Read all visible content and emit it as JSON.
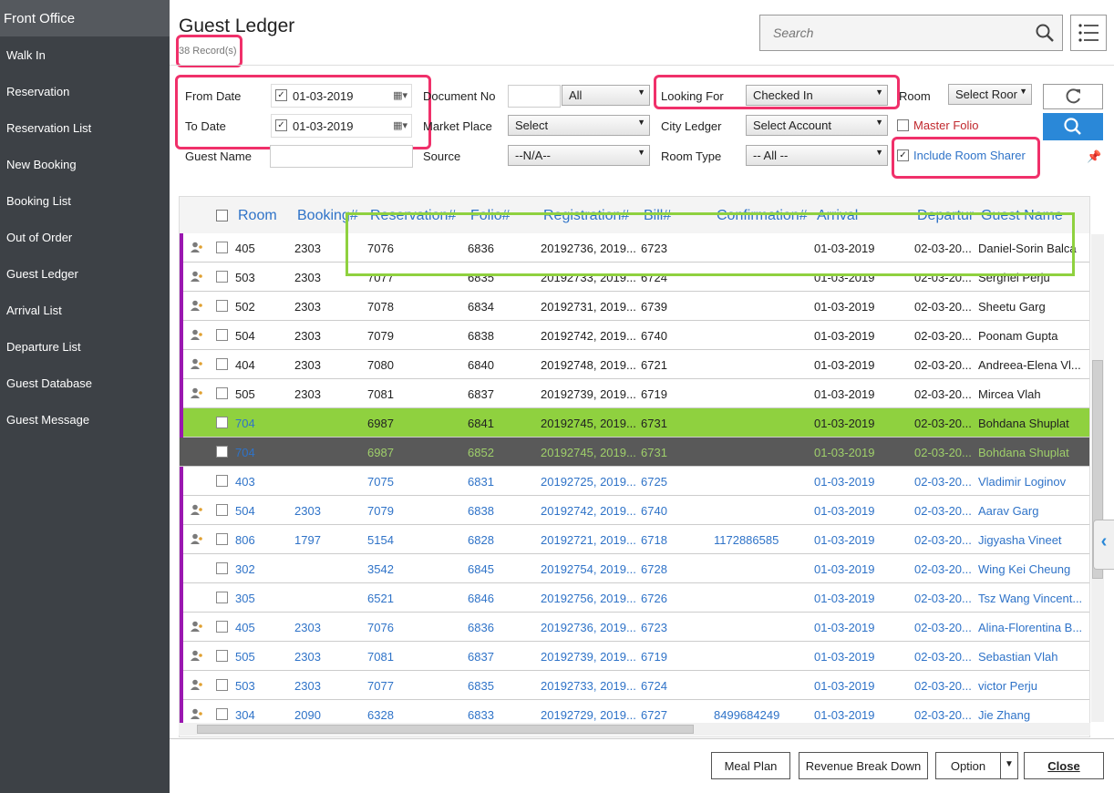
{
  "sidebar": {
    "header": "Front Office",
    "items": [
      "Walk In",
      "Reservation",
      "Reservation List",
      "New Booking",
      "Booking List",
      "Out of Order",
      "Guest Ledger",
      "Arrival List",
      "Departure List",
      "Guest Database",
      "Guest Message"
    ]
  },
  "page": {
    "title": "Guest Ledger",
    "record_count": "38 Record(s)",
    "search_placeholder": "Search"
  },
  "filters": {
    "from_date_label": "From Date",
    "from_date_value": "01-03-2019",
    "to_date_label": "To Date",
    "to_date_value": "01-03-2019",
    "guest_name_label": "Guest Name",
    "document_no_label": "Document No",
    "document_no_select": "All",
    "market_place_label": "Market Place",
    "market_place_value": "Select",
    "source_label": "Source",
    "source_value": "--N/A--",
    "looking_for_label": "Looking For",
    "looking_for_value": "Checked In",
    "city_ledger_label": "City Ledger",
    "city_ledger_value": "Select Account",
    "room_type_label": "Room Type",
    "room_type_value": "-- All --",
    "room_label": "Room",
    "room_value": "Select Roor",
    "master_folio_label": "Master Folio",
    "include_room_sharer_label": "Include Room Sharer"
  },
  "grid": {
    "columns": [
      "Room",
      "Booking#",
      "Reservation#",
      "Folio#",
      "Registration#",
      "Bill#",
      "Confirmation#",
      "Arrival",
      "Departur",
      "Guest Name"
    ],
    "rows": [
      {
        "room": "405",
        "booking": "2303",
        "reservation": "7076",
        "folio": "6836",
        "registration": "20192736, 2019...",
        "bill": "6723",
        "confirmation": "",
        "arrival": "01-03-2019",
        "departure": "02-03-20...",
        "guest": "Daniel-Sorin Balca"
      },
      {
        "room": "503",
        "booking": "2303",
        "reservation": "7077",
        "folio": "6835",
        "registration": "20192733, 2019...",
        "bill": "6724",
        "confirmation": "",
        "arrival": "01-03-2019",
        "departure": "02-03-20...",
        "guest": "Serghei Perju"
      },
      {
        "room": "502",
        "booking": "2303",
        "reservation": "7078",
        "folio": "6834",
        "registration": "20192731, 2019...",
        "bill": "6739",
        "confirmation": "",
        "arrival": "01-03-2019",
        "departure": "02-03-20...",
        "guest": "Sheetu Garg"
      },
      {
        "room": "504",
        "booking": "2303",
        "reservation": "7079",
        "folio": "6838",
        "registration": "20192742, 2019...",
        "bill": "6740",
        "confirmation": "",
        "arrival": "01-03-2019",
        "departure": "02-03-20...",
        "guest": "Poonam Gupta"
      },
      {
        "room": "404",
        "booking": "2303",
        "reservation": "7080",
        "folio": "6840",
        "registration": "20192748, 2019...",
        "bill": "6721",
        "confirmation": "",
        "arrival": "01-03-2019",
        "departure": "02-03-20...",
        "guest": "Andreea-Elena Vl..."
      },
      {
        "room": "505",
        "booking": "2303",
        "reservation": "7081",
        "folio": "6837",
        "registration": "20192739, 2019...",
        "bill": "6719",
        "confirmation": "",
        "arrival": "01-03-2019",
        "departure": "02-03-20...",
        "guest": "Mircea Vlah"
      },
      {
        "room": "704",
        "booking": "",
        "reservation": "6987",
        "folio": "6841",
        "registration": "20192745, 2019...",
        "bill": "6731",
        "confirmation": "",
        "arrival": "01-03-2019",
        "departure": "02-03-20...",
        "guest": "Bohdana Shuplat"
      },
      {
        "room": "704",
        "booking": "",
        "reservation": "6987",
        "folio": "6852",
        "registration": "20192745, 2019...",
        "bill": "6731",
        "confirmation": "",
        "arrival": "01-03-2019",
        "departure": "02-03-20...",
        "guest": "Bohdana Shuplat"
      },
      {
        "room": "403",
        "booking": "",
        "reservation": "7075",
        "folio": "6831",
        "registration": "20192725, 2019...",
        "bill": "6725",
        "confirmation": "",
        "arrival": "01-03-2019",
        "departure": "02-03-20...",
        "guest": "Vladimir Loginov"
      },
      {
        "room": "504",
        "booking": "2303",
        "reservation": "7079",
        "folio": "6838",
        "registration": "20192742, 2019...",
        "bill": "6740",
        "confirmation": "",
        "arrival": "01-03-2019",
        "departure": "02-03-20...",
        "guest": "Aarav Garg"
      },
      {
        "room": "806",
        "booking": "1797",
        "reservation": "5154",
        "folio": "6828",
        "registration": "20192721, 2019...",
        "bill": "6718",
        "confirmation": "1172886585",
        "arrival": "01-03-2019",
        "departure": "02-03-20...",
        "guest": "Jigyasha Vineet"
      },
      {
        "room": "302",
        "booking": "",
        "reservation": "3542",
        "folio": "6845",
        "registration": "20192754, 2019...",
        "bill": "6728",
        "confirmation": "",
        "arrival": "01-03-2019",
        "departure": "02-03-20...",
        "guest": "Wing Kei Cheung"
      },
      {
        "room": "305",
        "booking": "",
        "reservation": "6521",
        "folio": "6846",
        "registration": "20192756, 2019...",
        "bill": "6726",
        "confirmation": "",
        "arrival": "01-03-2019",
        "departure": "02-03-20...",
        "guest": "Tsz Wang Vincent..."
      },
      {
        "room": "405",
        "booking": "2303",
        "reservation": "7076",
        "folio": "6836",
        "registration": "20192736, 2019...",
        "bill": "6723",
        "confirmation": "",
        "arrival": "01-03-2019",
        "departure": "02-03-20...",
        "guest": "Alina-Florentina B..."
      },
      {
        "room": "505",
        "booking": "2303",
        "reservation": "7081",
        "folio": "6837",
        "registration": "20192739, 2019...",
        "bill": "6719",
        "confirmation": "",
        "arrival": "01-03-2019",
        "departure": "02-03-20...",
        "guest": "Sebastian Vlah"
      },
      {
        "room": "503",
        "booking": "2303",
        "reservation": "7077",
        "folio": "6835",
        "registration": "20192733, 2019...",
        "bill": "6724",
        "confirmation": "",
        "arrival": "01-03-2019",
        "departure": "02-03-20...",
        "guest": "victor Perju"
      },
      {
        "room": "304",
        "booking": "2090",
        "reservation": "6328",
        "folio": "6833",
        "registration": "20192729, 2019...",
        "bill": "6727",
        "confirmation": "8499684249",
        "arrival": "01-03-2019",
        "departure": "02-03-20...",
        "guest": "Jie Zhang"
      }
    ]
  },
  "footer": {
    "meal_plan": "Meal Plan",
    "revenue_break_down": "Revenue Break Down",
    "option": "Option",
    "close": "Close"
  },
  "colors": {
    "accent": "#2a88d8",
    "row_marker": "#9a17b0",
    "highlight": "#f0306a",
    "selected_green": "#8fd13f"
  }
}
